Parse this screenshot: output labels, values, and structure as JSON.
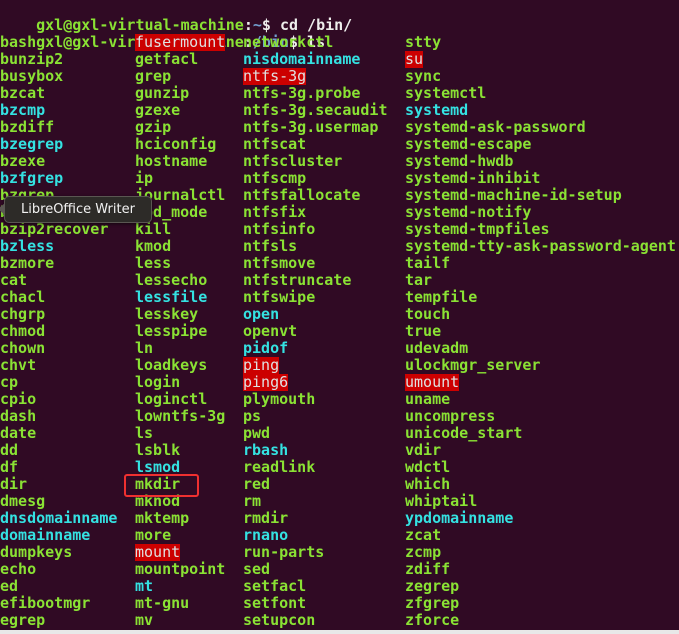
{
  "colors": {
    "background": "#300a24",
    "executable": "#8ae234",
    "symlink": "#34e2e2",
    "setuid_bg": "#cc0000",
    "highlight_box": "#f03030"
  },
  "prompt": {
    "user_host": "gxl@gxl-virtual-machine",
    "line1": {
      "path": "~",
      "command": "cd /bin/"
    },
    "line2": {
      "path": "/bin",
      "command": "ls"
    }
  },
  "tooltip": {
    "text": "LibreOffice Writer"
  },
  "highlighted_entry": "mkdir",
  "listing": {
    "columns": [
      [
        [
          "bash",
          "exec"
        ],
        [
          "bunzip2",
          "exec"
        ],
        [
          "busybox",
          "exec"
        ],
        [
          "bzcat",
          "exec"
        ],
        [
          "bzcmp",
          "link"
        ],
        [
          "bzdiff",
          "exec"
        ],
        [
          "bzegrep",
          "link"
        ],
        [
          "bzexe",
          "exec"
        ],
        [
          "bzfgrep",
          "link"
        ],
        [
          "bzgrep",
          "exec"
        ],
        [
          "bzip2",
          "exec"
        ],
        [
          "bzip2recover",
          "exec"
        ],
        [
          "bzless",
          "link"
        ],
        [
          "bzmore",
          "exec"
        ],
        [
          "cat",
          "exec"
        ],
        [
          "chacl",
          "exec"
        ],
        [
          "chgrp",
          "exec"
        ],
        [
          "chmod",
          "exec"
        ],
        [
          "chown",
          "exec"
        ],
        [
          "chvt",
          "exec"
        ],
        [
          "cp",
          "exec"
        ],
        [
          "cpio",
          "exec"
        ],
        [
          "dash",
          "exec"
        ],
        [
          "date",
          "exec"
        ],
        [
          "dd",
          "exec"
        ],
        [
          "df",
          "exec"
        ],
        [
          "dir",
          "exec"
        ],
        [
          "dmesg",
          "exec"
        ],
        [
          "dnsdomainname",
          "link"
        ],
        [
          "domainname",
          "link"
        ],
        [
          "dumpkeys",
          "exec"
        ],
        [
          "echo",
          "exec"
        ],
        [
          "ed",
          "exec"
        ],
        [
          "efibootmgr",
          "exec"
        ],
        [
          "egrep",
          "exec"
        ]
      ],
      [
        [
          "fusermount",
          "setuid"
        ],
        [
          "getfacl",
          "exec"
        ],
        [
          "grep",
          "exec"
        ],
        [
          "gunzip",
          "exec"
        ],
        [
          "gzexe",
          "exec"
        ],
        [
          "gzip",
          "exec"
        ],
        [
          "hciconfig",
          "exec"
        ],
        [
          "hostname",
          "exec"
        ],
        [
          "ip",
          "exec"
        ],
        [
          "journalctl",
          "exec"
        ],
        [
          "kbd_mode",
          "exec"
        ],
        [
          "kill",
          "exec"
        ],
        [
          "kmod",
          "exec"
        ],
        [
          "less",
          "exec"
        ],
        [
          "lessecho",
          "exec"
        ],
        [
          "lessfile",
          "link"
        ],
        [
          "lesskey",
          "exec"
        ],
        [
          "lesspipe",
          "exec"
        ],
        [
          "ln",
          "exec"
        ],
        [
          "loadkeys",
          "exec"
        ],
        [
          "login",
          "exec"
        ],
        [
          "loginctl",
          "exec"
        ],
        [
          "lowntfs-3g",
          "exec"
        ],
        [
          "ls",
          "exec"
        ],
        [
          "lsblk",
          "exec"
        ],
        [
          "lsmod",
          "link"
        ],
        [
          "mkdir",
          "exec"
        ],
        [
          "mknod",
          "exec"
        ],
        [
          "mktemp",
          "exec"
        ],
        [
          "more",
          "exec"
        ],
        [
          "mount",
          "setuid"
        ],
        [
          "mountpoint",
          "exec"
        ],
        [
          "mt",
          "link"
        ],
        [
          "mt-gnu",
          "exec"
        ],
        [
          "mv",
          "exec"
        ]
      ],
      [
        [
          "networkctl",
          "exec"
        ],
        [
          "nisdomainname",
          "link"
        ],
        [
          "ntfs-3g",
          "setuid"
        ],
        [
          "ntfs-3g.probe",
          "exec"
        ],
        [
          "ntfs-3g.secaudit",
          "exec"
        ],
        [
          "ntfs-3g.usermap",
          "exec"
        ],
        [
          "ntfscat",
          "exec"
        ],
        [
          "ntfscluster",
          "exec"
        ],
        [
          "ntfscmp",
          "exec"
        ],
        [
          "ntfsfallocate",
          "exec"
        ],
        [
          "ntfsfix",
          "exec"
        ],
        [
          "ntfsinfo",
          "exec"
        ],
        [
          "ntfsls",
          "exec"
        ],
        [
          "ntfsmove",
          "exec"
        ],
        [
          "ntfstruncate",
          "exec"
        ],
        [
          "ntfswipe",
          "exec"
        ],
        [
          "open",
          "link"
        ],
        [
          "openvt",
          "exec"
        ],
        [
          "pidof",
          "link"
        ],
        [
          "ping",
          "setuid"
        ],
        [
          "ping6",
          "setuid"
        ],
        [
          "plymouth",
          "exec"
        ],
        [
          "ps",
          "exec"
        ],
        [
          "pwd",
          "exec"
        ],
        [
          "rbash",
          "link"
        ],
        [
          "readlink",
          "exec"
        ],
        [
          "red",
          "exec"
        ],
        [
          "rm",
          "exec"
        ],
        [
          "rmdir",
          "exec"
        ],
        [
          "rnano",
          "link"
        ],
        [
          "run-parts",
          "exec"
        ],
        [
          "sed",
          "exec"
        ],
        [
          "setfacl",
          "exec"
        ],
        [
          "setfont",
          "exec"
        ],
        [
          "setupcon",
          "exec"
        ]
      ],
      [
        [
          "stty",
          "exec"
        ],
        [
          "su",
          "setuid"
        ],
        [
          "sync",
          "exec"
        ],
        [
          "systemctl",
          "exec"
        ],
        [
          "systemd",
          "link"
        ],
        [
          "systemd-ask-password",
          "exec"
        ],
        [
          "systemd-escape",
          "exec"
        ],
        [
          "systemd-hwdb",
          "exec"
        ],
        [
          "systemd-inhibit",
          "exec"
        ],
        [
          "systemd-machine-id-setup",
          "exec"
        ],
        [
          "systemd-notify",
          "exec"
        ],
        [
          "systemd-tmpfiles",
          "exec"
        ],
        [
          "systemd-tty-ask-password-agent",
          "exec"
        ],
        [
          "tailf",
          "exec"
        ],
        [
          "tar",
          "exec"
        ],
        [
          "tempfile",
          "exec"
        ],
        [
          "touch",
          "exec"
        ],
        [
          "true",
          "exec"
        ],
        [
          "udevadm",
          "exec"
        ],
        [
          "ulockmgr_server",
          "exec"
        ],
        [
          "umount",
          "setuid"
        ],
        [
          "uname",
          "exec"
        ],
        [
          "uncompress",
          "exec"
        ],
        [
          "unicode_start",
          "exec"
        ],
        [
          "vdir",
          "exec"
        ],
        [
          "wdctl",
          "exec"
        ],
        [
          "which",
          "exec"
        ],
        [
          "whiptail",
          "exec"
        ],
        [
          "ypdomainname",
          "link"
        ],
        [
          "zcat",
          "exec"
        ],
        [
          "zcmp",
          "exec"
        ],
        [
          "zdiff",
          "exec"
        ],
        [
          "zegrep",
          "exec"
        ],
        [
          "zfgrep",
          "exec"
        ],
        [
          "zforce",
          "exec"
        ]
      ]
    ]
  }
}
